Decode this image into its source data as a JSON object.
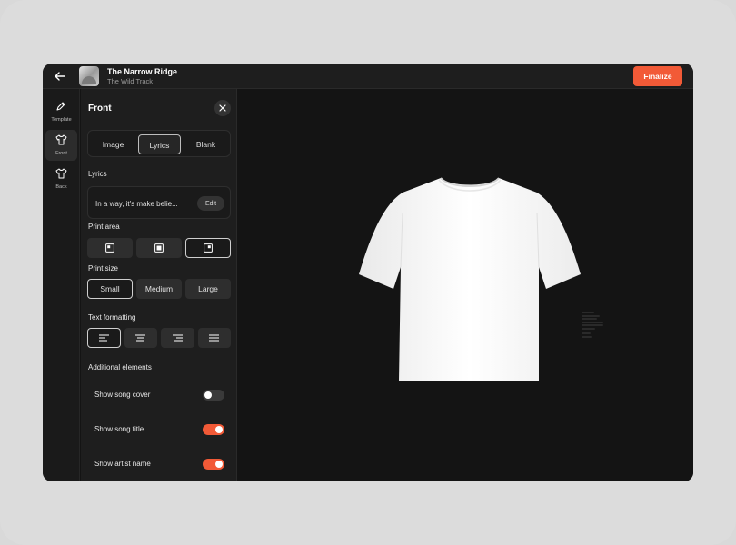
{
  "header": {
    "song_title": "The Narrow Ridge",
    "artist": "The Wild Track",
    "finalize_label": "Finalize"
  },
  "rail": {
    "items": [
      {
        "label": "Template",
        "icon": "pencil-icon",
        "active": false
      },
      {
        "label": "Front",
        "icon": "tshirt-icon",
        "active": true
      },
      {
        "label": "Back",
        "icon": "tshirt-icon",
        "active": false
      }
    ]
  },
  "panel": {
    "title": "Front",
    "content_tabs": [
      {
        "label": "Image",
        "selected": false
      },
      {
        "label": "Lyrics",
        "selected": true
      },
      {
        "label": "Blank",
        "selected": false
      }
    ],
    "lyrics_label": "Lyrics",
    "lyrics_value": "In a way, it's make belie...",
    "edit_label": "Edit",
    "print_area_label": "Print area",
    "print_areas": [
      {
        "icon": "area-left-icon",
        "selected": false
      },
      {
        "icon": "area-center-icon",
        "selected": false
      },
      {
        "icon": "area-right-icon",
        "selected": true
      }
    ],
    "print_size_label": "Print size",
    "print_sizes": [
      {
        "label": "Small",
        "selected": true
      },
      {
        "label": "Medium",
        "selected": false
      },
      {
        "label": "Large",
        "selected": false
      }
    ],
    "text_formatting_label": "Text formatting",
    "alignments": [
      {
        "icon": "align-left-icon",
        "selected": true
      },
      {
        "icon": "align-center-icon",
        "selected": false
      },
      {
        "icon": "align-right-icon",
        "selected": false
      },
      {
        "icon": "align-justify-icon",
        "selected": false
      }
    ],
    "additional_label": "Additional elements",
    "toggles": [
      {
        "label": "Show song cover",
        "on": false
      },
      {
        "label": "Show song title",
        "on": true
      },
      {
        "label": "Show artist name",
        "on": true
      }
    ]
  },
  "colors": {
    "accent": "#f25a37",
    "background": "#141414",
    "panel": "#1e1e1e"
  }
}
